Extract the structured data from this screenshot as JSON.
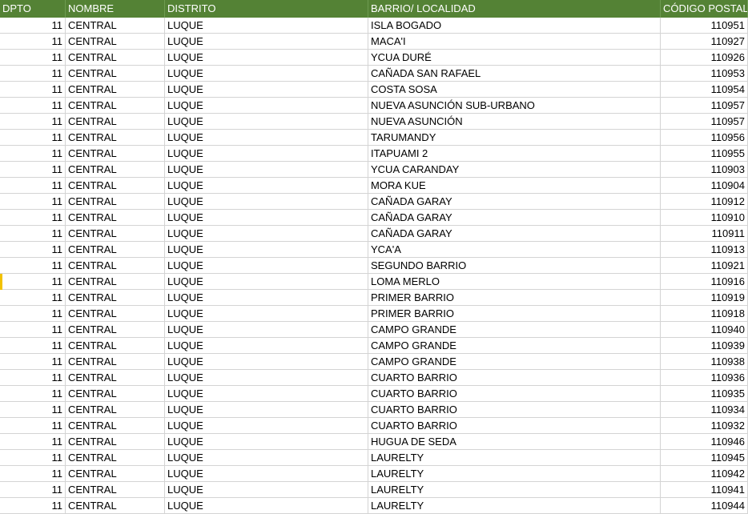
{
  "header": {
    "dpto": "DPTO",
    "nombre": "NOMBRE",
    "distrito": "DISTRITO",
    "barrio": "BARRIO/ LOCALIDAD",
    "codigo": "CÓDIGO POSTAL"
  },
  "colors": {
    "header_bg": "#548235",
    "header_text": "#ffffff",
    "gridline": "#d4d4d4",
    "active_row_marker": "#f2c200"
  },
  "active_row_index": 16,
  "rows": [
    {
      "dpto": "11",
      "nombre": "CENTRAL",
      "distrito": "LUQUE",
      "barrio": "ISLA BOGADO",
      "codigo": "110951"
    },
    {
      "dpto": "11",
      "nombre": "CENTRAL",
      "distrito": "LUQUE",
      "barrio": "MACA'I",
      "codigo": "110927"
    },
    {
      "dpto": "11",
      "nombre": "CENTRAL",
      "distrito": "LUQUE",
      "barrio": "YCUA DURÉ",
      "codigo": "110926"
    },
    {
      "dpto": "11",
      "nombre": "CENTRAL",
      "distrito": "LUQUE",
      "barrio": "CAÑADA SAN RAFAEL",
      "codigo": "110953"
    },
    {
      "dpto": "11",
      "nombre": "CENTRAL",
      "distrito": "LUQUE",
      "barrio": "COSTA SOSA",
      "codigo": "110954"
    },
    {
      "dpto": "11",
      "nombre": "CENTRAL",
      "distrito": "LUQUE",
      "barrio": "NUEVA ASUNCIÓN SUB-URBANO",
      "codigo": "110957"
    },
    {
      "dpto": "11",
      "nombre": "CENTRAL",
      "distrito": "LUQUE",
      "barrio": "NUEVA ASUNCIÓN",
      "codigo": "110957"
    },
    {
      "dpto": "11",
      "nombre": "CENTRAL",
      "distrito": "LUQUE",
      "barrio": "TARUMANDY",
      "codigo": "110956"
    },
    {
      "dpto": "11",
      "nombre": "CENTRAL",
      "distrito": "LUQUE",
      "barrio": "ITAPUAMI 2",
      "codigo": "110955"
    },
    {
      "dpto": "11",
      "nombre": "CENTRAL",
      "distrito": "LUQUE",
      "barrio": "YCUA CARANDAY",
      "codigo": "110903"
    },
    {
      "dpto": "11",
      "nombre": "CENTRAL",
      "distrito": "LUQUE",
      "barrio": "MORA KUE",
      "codigo": "110904"
    },
    {
      "dpto": "11",
      "nombre": "CENTRAL",
      "distrito": "LUQUE",
      "barrio": "CAÑADA GARAY",
      "codigo": "110912"
    },
    {
      "dpto": "11",
      "nombre": "CENTRAL",
      "distrito": "LUQUE",
      "barrio": "CAÑADA GARAY",
      "codigo": "110910"
    },
    {
      "dpto": "11",
      "nombre": "CENTRAL",
      "distrito": "LUQUE",
      "barrio": "CAÑADA GARAY",
      "codigo": "110911"
    },
    {
      "dpto": "11",
      "nombre": "CENTRAL",
      "distrito": "LUQUE",
      "barrio": "YCA'A",
      "codigo": "110913"
    },
    {
      "dpto": "11",
      "nombre": "CENTRAL",
      "distrito": "LUQUE",
      "barrio": "SEGUNDO BARRIO",
      "codigo": "110921"
    },
    {
      "dpto": "11",
      "nombre": "CENTRAL",
      "distrito": "LUQUE",
      "barrio": "LOMA MERLO",
      "codigo": "110916"
    },
    {
      "dpto": "11",
      "nombre": "CENTRAL",
      "distrito": "LUQUE",
      "barrio": "PRIMER BARRIO",
      "codigo": "110919"
    },
    {
      "dpto": "11",
      "nombre": "CENTRAL",
      "distrito": "LUQUE",
      "barrio": "PRIMER BARRIO",
      "codigo": "110918"
    },
    {
      "dpto": "11",
      "nombre": "CENTRAL",
      "distrito": "LUQUE",
      "barrio": "CAMPO GRANDE",
      "codigo": "110940"
    },
    {
      "dpto": "11",
      "nombre": "CENTRAL",
      "distrito": "LUQUE",
      "barrio": "CAMPO GRANDE",
      "codigo": "110939"
    },
    {
      "dpto": "11",
      "nombre": "CENTRAL",
      "distrito": "LUQUE",
      "barrio": "CAMPO GRANDE",
      "codigo": "110938"
    },
    {
      "dpto": "11",
      "nombre": "CENTRAL",
      "distrito": "LUQUE",
      "barrio": "CUARTO BARRIO",
      "codigo": "110936"
    },
    {
      "dpto": "11",
      "nombre": "CENTRAL",
      "distrito": "LUQUE",
      "barrio": "CUARTO BARRIO",
      "codigo": "110935"
    },
    {
      "dpto": "11",
      "nombre": "CENTRAL",
      "distrito": "LUQUE",
      "barrio": "CUARTO BARRIO",
      "codigo": "110934"
    },
    {
      "dpto": "11",
      "nombre": "CENTRAL",
      "distrito": "LUQUE",
      "barrio": "CUARTO BARRIO",
      "codigo": "110932"
    },
    {
      "dpto": "11",
      "nombre": "CENTRAL",
      "distrito": "LUQUE",
      "barrio": "HUGUA DE SEDA",
      "codigo": "110946"
    },
    {
      "dpto": "11",
      "nombre": "CENTRAL",
      "distrito": "LUQUE",
      "barrio": "LAURELTY",
      "codigo": "110945"
    },
    {
      "dpto": "11",
      "nombre": "CENTRAL",
      "distrito": "LUQUE",
      "barrio": "LAURELTY",
      "codigo": "110942"
    },
    {
      "dpto": "11",
      "nombre": "CENTRAL",
      "distrito": "LUQUE",
      "barrio": "LAURELTY",
      "codigo": "110941"
    },
    {
      "dpto": "11",
      "nombre": "CENTRAL",
      "distrito": "LUQUE",
      "barrio": "LAURELTY",
      "codigo": "110944"
    }
  ]
}
